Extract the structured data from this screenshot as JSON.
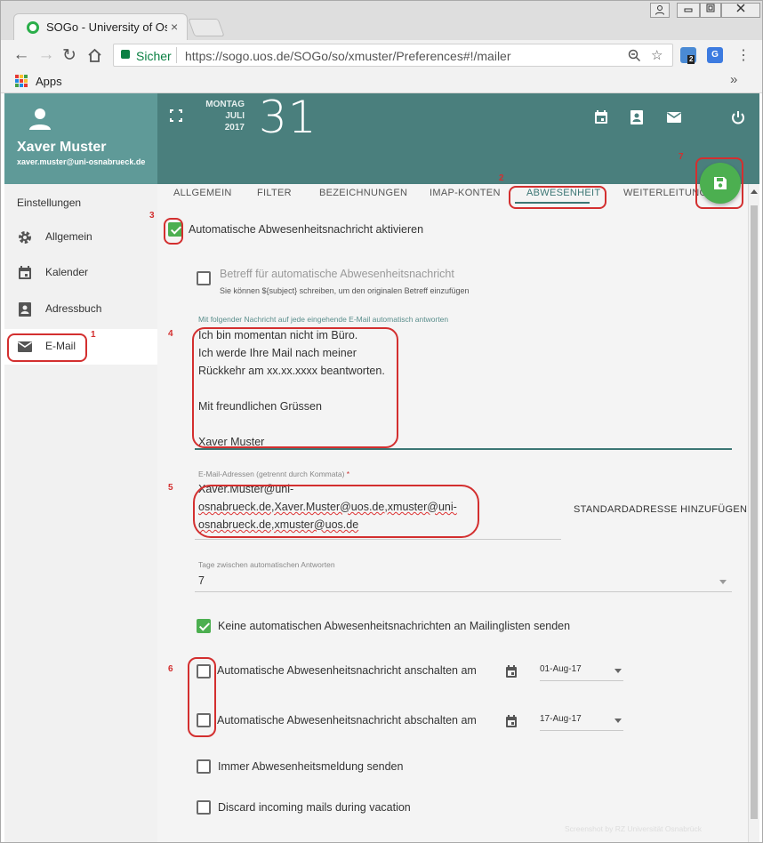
{
  "browser": {
    "tab_title": "SOGo - University of Osnabrück",
    "tab_close": "×",
    "secure_label": "Sicher",
    "url": "https://sogo.uos.de/SOGo/so/xmuster/Preferences#!/mailer",
    "ext_badge": "2",
    "apps_label": "Apps",
    "bookmarks_more": "»"
  },
  "user": {
    "name": "Xaver Muster",
    "email": "xaver.muster@uni-osnabrueck.de"
  },
  "date": {
    "weekday": "MONTAG",
    "month": "JULI",
    "year": "2017",
    "day": "31"
  },
  "sidebar": {
    "title": "Einstellungen",
    "items": [
      {
        "label": "Allgemein",
        "icon": "gear-icon"
      },
      {
        "label": "Kalender",
        "icon": "calendar-icon"
      },
      {
        "label": "Adressbuch",
        "icon": "contacts-icon"
      },
      {
        "label": "E-Mail",
        "icon": "mail-icon"
      }
    ]
  },
  "tabs": [
    "ALLGEMEIN",
    "FILTER",
    "BEZEICHNUNGEN",
    "IMAP-KONTEN",
    "ABWESENHEIT",
    "WEITERLEITUNG"
  ],
  "active_tab": "ABWESENHEIT",
  "vacation": {
    "enable_label": "Automatische Abwesenheitsnachricht aktivieren",
    "enable_checked": true,
    "subject_label": "Betreff für automatische Abwesenheitsnachricht",
    "subject_hint": "Sie können ${subject} schreiben, um den originalen Betreff einzufügen",
    "subject_checked": false,
    "message_label": "Mit folgender Nachricht auf jede eingehende E-Mail automatisch antworten",
    "message_lines": [
      "Ich bin momentan nicht im Büro.",
      "Ich werde Ihre Mail nach meiner",
      "Rückkehr am xx.xx.xxxx beantworten.",
      "",
      "Mit freundlichen Grüssen",
      "",
      "Xaver Muster"
    ],
    "addresses_label": "E-Mail-Adressen (getrennt durch Kommata)",
    "required_mark": "*",
    "addresses_lines": [
      "Xaver.Muster@uni-",
      "osnabrueck.de,Xaver.Muster@uos.de,xmuster@uni-",
      "osnabrueck.de,xmuster@uos.de"
    ],
    "add_default_label": "STANDARDADRESSE HINZUFÜGEN",
    "days_label": "Tage zwischen automatischen Antworten",
    "days_value": "7",
    "no_lists_label": "Keine automatischen Abwesenheitsnachrichten an Mailinglisten senden",
    "no_lists_checked": true,
    "start_label": "Automatische Abwesenheitsnachricht anschalten am",
    "start_date": "01-Aug-17",
    "start_checked": false,
    "end_label": "Automatische Abwesenheitsnachricht abschalten am",
    "end_date": "17-Aug-17",
    "end_checked": false,
    "always_label": "Immer Abwesenheitsmeldung senden",
    "always_checked": false,
    "discard_label": "Discard incoming mails during vacation",
    "discard_checked": false
  },
  "annotations": [
    "1",
    "2",
    "3",
    "4",
    "5",
    "6",
    "7"
  ],
  "credit": "Screenshot by RZ Universität Osnabrück",
  "colors": {
    "header": "#4a7f7d",
    "sidebar_header": "#5f9a98",
    "accent": "#3c7674",
    "fab": "#4caf50",
    "annotation": "#d32f2f"
  }
}
